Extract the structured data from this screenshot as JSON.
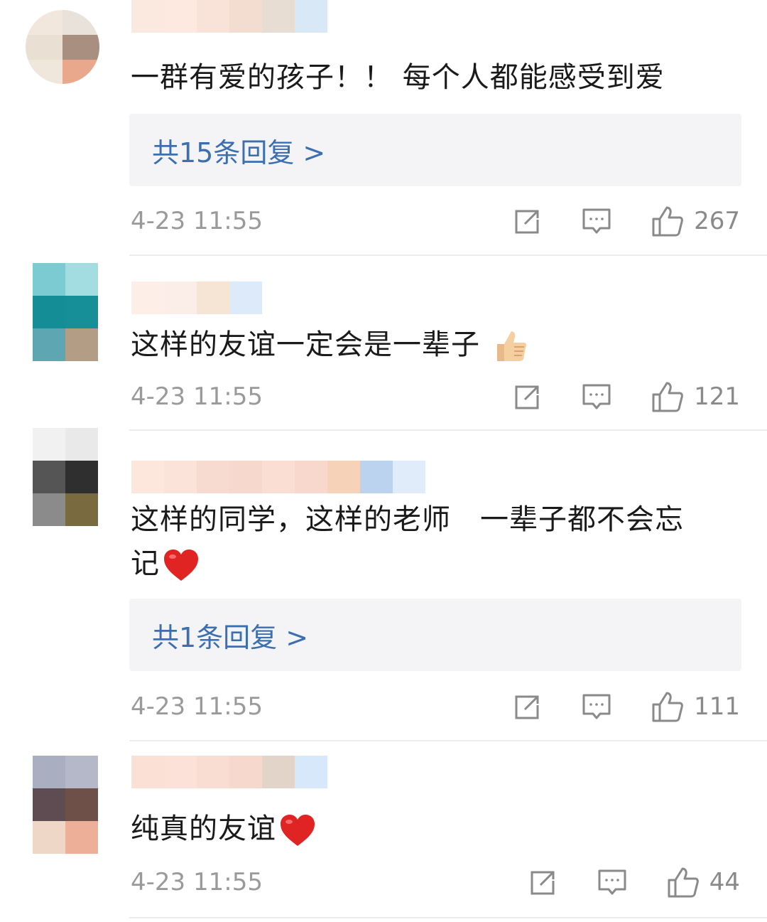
{
  "comments": [
    {
      "text": "一群有爱的孩子！！ 每个人都能感受到爱",
      "reply_label": "共15条回复 >",
      "time": "4-23 11:55",
      "likes": "267",
      "emoji": "none"
    },
    {
      "text": "这样的友谊一定会是一辈子",
      "reply_label": "",
      "time": "4-23 11:55",
      "likes": "121",
      "emoji": "thumbs-up"
    },
    {
      "text_line1": "这样的同学，这样的老师　一辈子都不会忘",
      "text_line2": "记",
      "reply_label": "共1条回复 >",
      "time": "4-23 11:55",
      "likes": "111",
      "emoji": "heart"
    },
    {
      "text": "纯真的友谊",
      "reply_label": "",
      "time": "4-23 11:55",
      "likes": "44",
      "emoji": "heart"
    }
  ],
  "colors": {
    "link": "#3b6fb0",
    "meta": "#9a9a9a",
    "reply_bg": "#f4f4f6",
    "heart": "#e02424"
  },
  "icons": [
    "share-icon",
    "comment-icon",
    "like-icon",
    "heart-emoji-icon",
    "thumbs-up-emoji-icon"
  ]
}
